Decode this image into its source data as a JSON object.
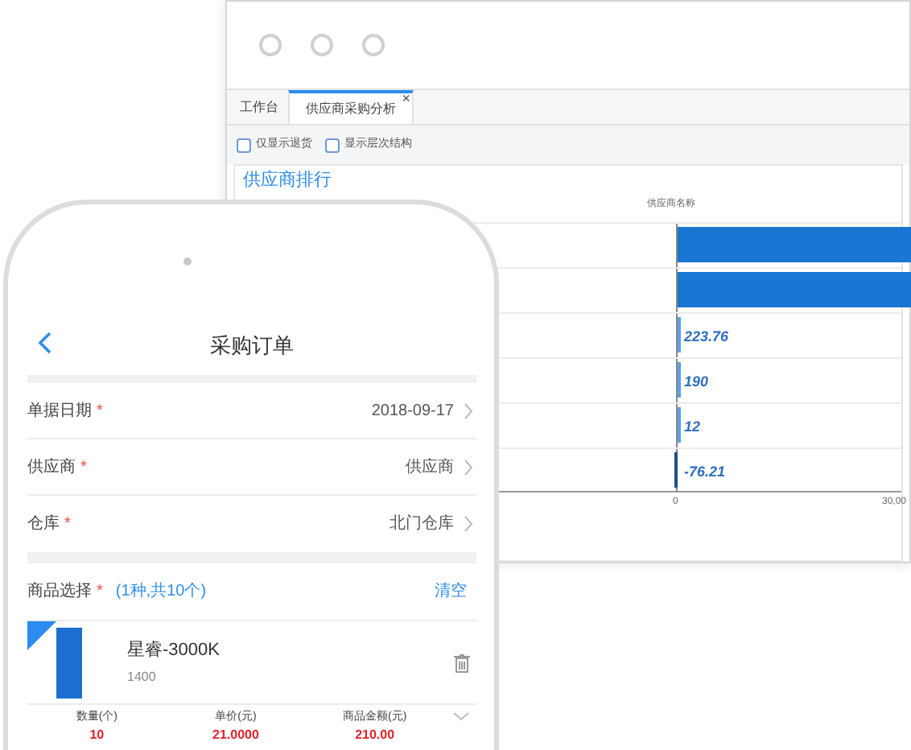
{
  "desktop": {
    "tabs": [
      {
        "label": "工作台",
        "selected": false,
        "closable": false
      },
      {
        "label": "供应商采购分析",
        "selected": true,
        "closable": true
      }
    ],
    "close_glyph": "×",
    "filters": [
      {
        "label": "仅显示退货",
        "checked": false
      },
      {
        "label": "显示层次结构",
        "checked": false
      }
    ],
    "section_title": "供应商排行",
    "chart": {
      "title": "供应商名称",
      "bars": [
        {
          "kind": "overflow"
        },
        {
          "kind": "overflow"
        },
        {
          "kind": "small",
          "label": "223.76"
        },
        {
          "kind": "small",
          "label": "190"
        },
        {
          "kind": "small",
          "label": "12"
        },
        {
          "kind": "negative",
          "label": "-76.21"
        }
      ],
      "ticks": [
        "0",
        "30,00"
      ]
    }
  },
  "phone": {
    "title": "采购订单",
    "required_mark": "*",
    "fields": [
      {
        "label": "单据日期",
        "required": true,
        "value": "2018-09-17"
      },
      {
        "label": "供应商",
        "required": true,
        "value": "供应商"
      },
      {
        "label": "仓库",
        "required": true,
        "value": "北门仓库"
      }
    ],
    "goods": {
      "label": "商品选择",
      "required": true,
      "summary": "(1种,共10个)",
      "clear": "清空",
      "item": {
        "name": "星睿-3000K",
        "code": "1400",
        "columns": [
          {
            "label": "数量(个)",
            "value": "10"
          },
          {
            "label": "单价(元)",
            "value": "21.0000"
          },
          {
            "label": "商品金额(元)",
            "value": "210.00"
          }
        ]
      }
    }
  }
}
